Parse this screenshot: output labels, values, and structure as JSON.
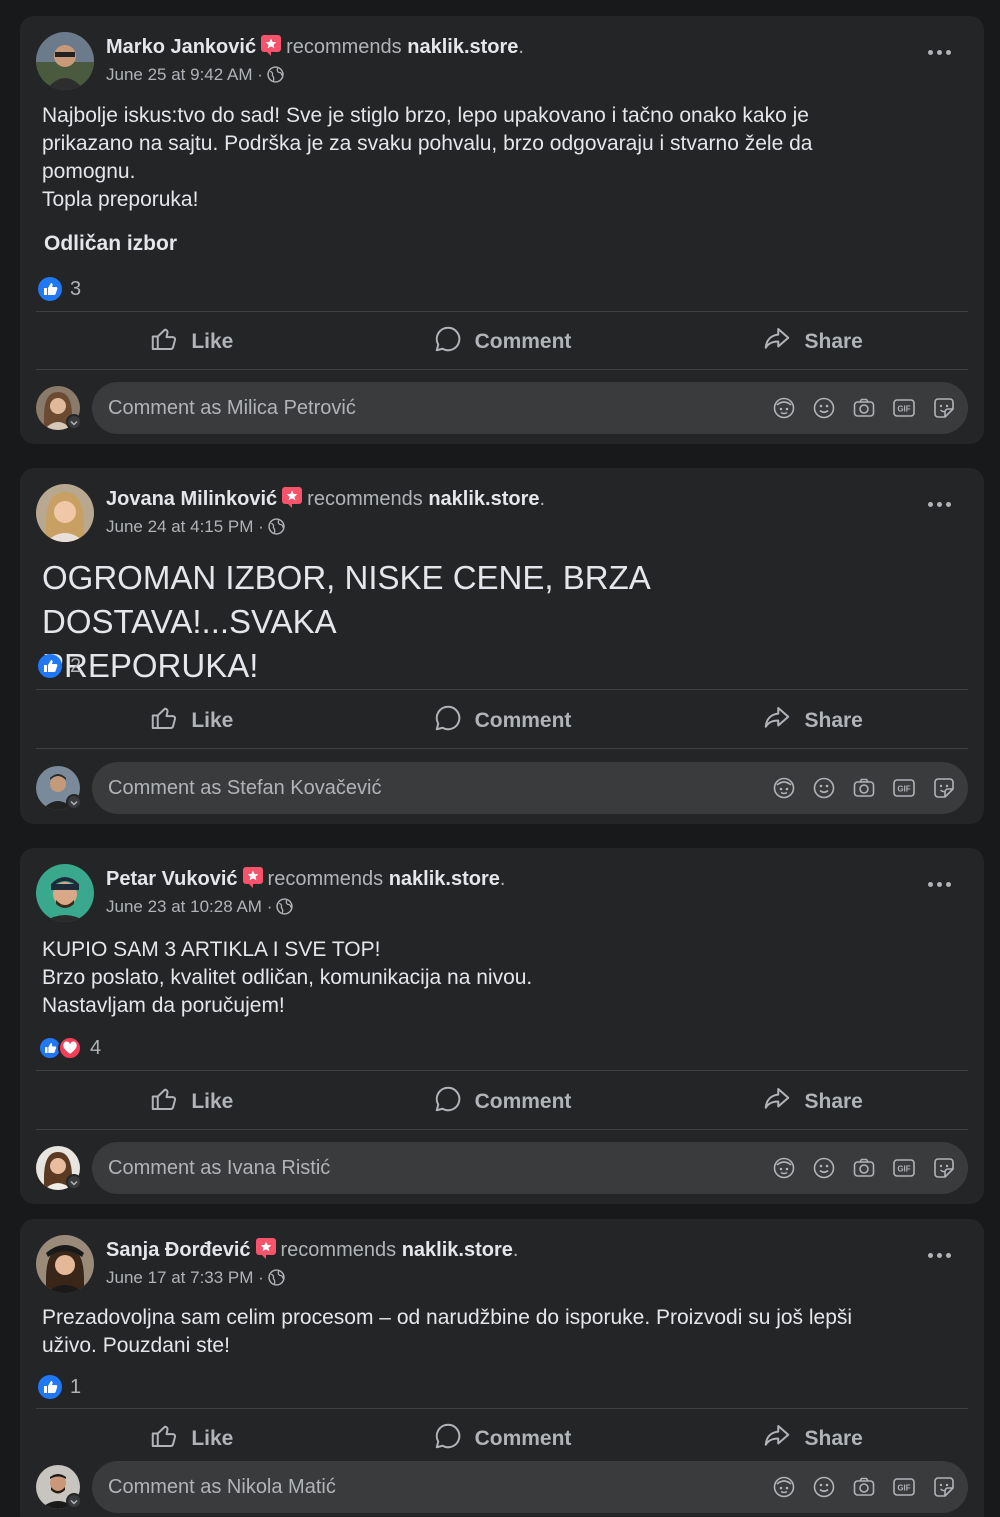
{
  "common": {
    "rec_text": "recommends",
    "page_name": "naklik.store",
    "dot_end": ".",
    "like_label": "Like",
    "comment_label": "Comment",
    "share_label": "Share",
    "meta_sep": "·"
  },
  "colors": {
    "background": "#18191a",
    "card": "#242526",
    "like_blue": "#2078f4",
    "love_red": "#f33e58",
    "recommend_badge": "#f7536a",
    "muted_text": "#b0b3b8"
  },
  "posts": [
    {
      "author": "Marko Janković",
      "timestamp": "June 25 at 9:42 AM",
      "text_lines": [
        "Najbolje iskus:tvo do sad! Sve je stiglo brzo, lepo upakovano i tačno onako kako je",
        "prikazano na sajtu. Podrška je za svaku pohvalu, brzo odgovaraju i stvarno žele da",
        "pomognu.",
        "Topla preporuka!"
      ],
      "subtitle": "Odličan izbor",
      "reactions": [
        "like"
      ],
      "reaction_count": "3",
      "commenter_placeholder": "Comment as Milica Petrović"
    },
    {
      "author": "Jovana Milinković",
      "timestamp": "June 24 at 4:15 PM",
      "text_lines": [
        "OGROMAN IZBOR, NISKE CENE, BRZA DOSTAVA!...SVAKA",
        "PREPORUKA!"
      ],
      "reactions": [
        "like"
      ],
      "reaction_count": "2",
      "commenter_placeholder": "Comment as Stefan Kovačević"
    },
    {
      "author": "Petar Vuković",
      "timestamp": "June 23 at 10:28 AM",
      "text_lines": [
        "KUPIO SAM 3 ARTIKLA I SVE TOP!",
        "Brzo poslato, kvalitet odličan, komunikacija na nivou.",
        "Nastavljam da poručujem!"
      ],
      "reactions": [
        "like",
        "love"
      ],
      "reaction_count": "4",
      "commenter_placeholder": "Comment as Ivana Ristić"
    },
    {
      "author": "Sanja Đorđević",
      "timestamp": "June 17 at 7:33 PM",
      "text_lines": [
        "Prezadovoljna sam celim procesom – od narudžbine do isporuke. Proizvodi su još lepši",
        "uživo. Pouzdani ste!"
      ],
      "reactions": [
        "like"
      ],
      "reaction_count": "1",
      "commenter_placeholder": "Comment as Nikola Matić"
    }
  ]
}
